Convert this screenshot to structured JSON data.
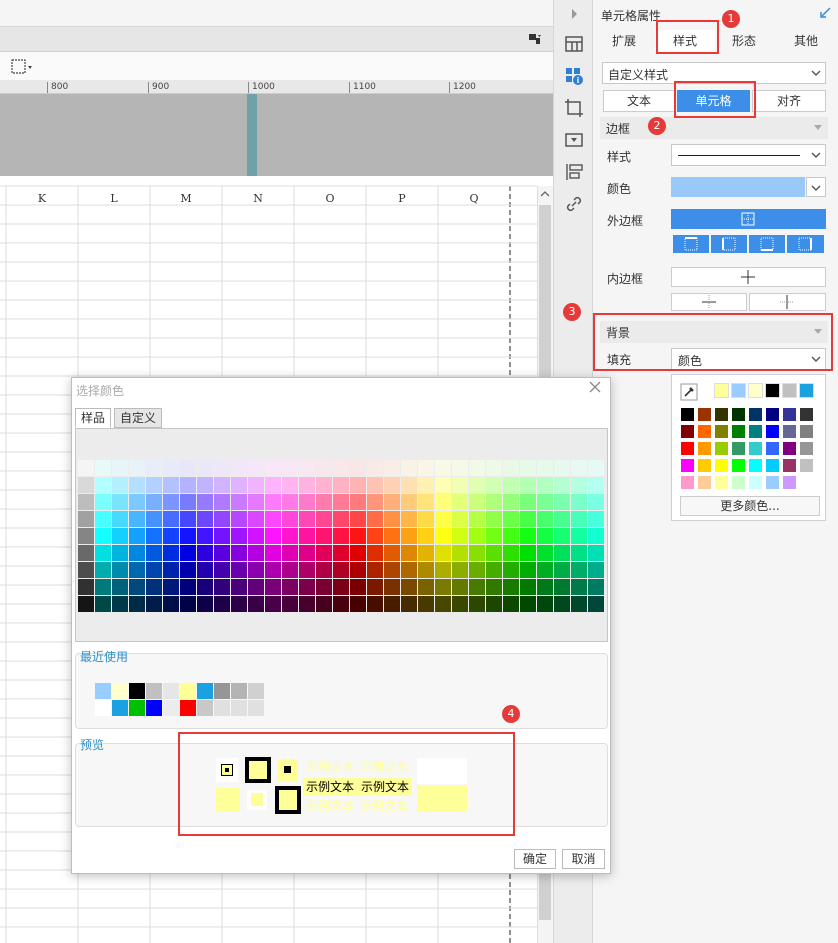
{
  "spreadsheet": {
    "ruler_ticks": [
      "800",
      "900",
      "1000",
      "1100",
      "1200"
    ],
    "column_headers": [
      "K",
      "L",
      "M",
      "N",
      "O",
      "P",
      "Q"
    ]
  },
  "panel": {
    "title": "单元格属性",
    "tabs": [
      {
        "label": "扩展",
        "active": false
      },
      {
        "label": "样式",
        "active": true
      },
      {
        "label": "形态",
        "active": false
      },
      {
        "label": "其他",
        "active": false
      }
    ],
    "style_select": "自定义样式",
    "subtabs": [
      {
        "label": "文本",
        "active": false
      },
      {
        "label": "单元格",
        "active": true
      },
      {
        "label": "对齐",
        "active": false
      }
    ],
    "border_section": "边框",
    "style_label": "样式",
    "color_label": "颜色",
    "border_color": "#99c9f8",
    "outer_border_label": "外边框",
    "inner_border_label": "内边框",
    "background_section": "背景",
    "fill_label": "填充",
    "fill_select": "颜色",
    "more_colors": "更多颜色..."
  },
  "badges": [
    "1",
    "2",
    "3",
    "4"
  ],
  "dialog": {
    "title": "选择颜色",
    "tabs": [
      {
        "label": "样品",
        "active": true
      },
      {
        "label": "自定义",
        "active": false
      }
    ],
    "recent_label": "最近使用",
    "preview_label": "预览",
    "sample_text": "示例文本",
    "ok_label": "确定",
    "cancel_label": "取消",
    "preview_color": "#ffff99"
  },
  "popup_top_row": [
    "#ffff99",
    "#99ccff",
    "#ffffcc",
    "#000000",
    "#c0c0c0",
    "#1ba1e2"
  ],
  "popup_grid": [
    [
      "#000000",
      "#993300",
      "#333300",
      "#003300",
      "#003366",
      "#000080",
      "#333399",
      "#333333"
    ],
    [
      "#800000",
      "#ff6600",
      "#808000",
      "#008000",
      "#008080",
      "#0000ff",
      "#666699",
      "#808080"
    ],
    [
      "#ff0000",
      "#ff9900",
      "#99cc00",
      "#339966",
      "#33cccc",
      "#3366ff",
      "#800080",
      "#969696"
    ],
    [
      "#ff00ff",
      "#ffcc00",
      "#ffff00",
      "#00ff00",
      "#00ffff",
      "#00ccff",
      "#993366",
      "#c0c0c0"
    ],
    [
      "#ff99cc",
      "#ffcc99",
      "#ffff99",
      "#ccffcc",
      "#ccffff",
      "#99ccff",
      "#cc99ff",
      "#ffffff"
    ]
  ],
  "recent_colors": [
    [
      "#99ccff",
      "#ffffcc",
      "#000000",
      "#c0c0c0",
      "#e6e6e6",
      "#ffff99",
      "#1ba1e2",
      "#969696",
      "#b4b4b4",
      "#d0d0d0"
    ],
    [
      "#ffffff",
      "#1ba1e2",
      "#00c000",
      "#0000ff",
      "#ececec",
      "#ff0000",
      "#c8c8c8",
      "#e0e0e0",
      "#e0e0e0",
      "#e0e0e0"
    ]
  ]
}
